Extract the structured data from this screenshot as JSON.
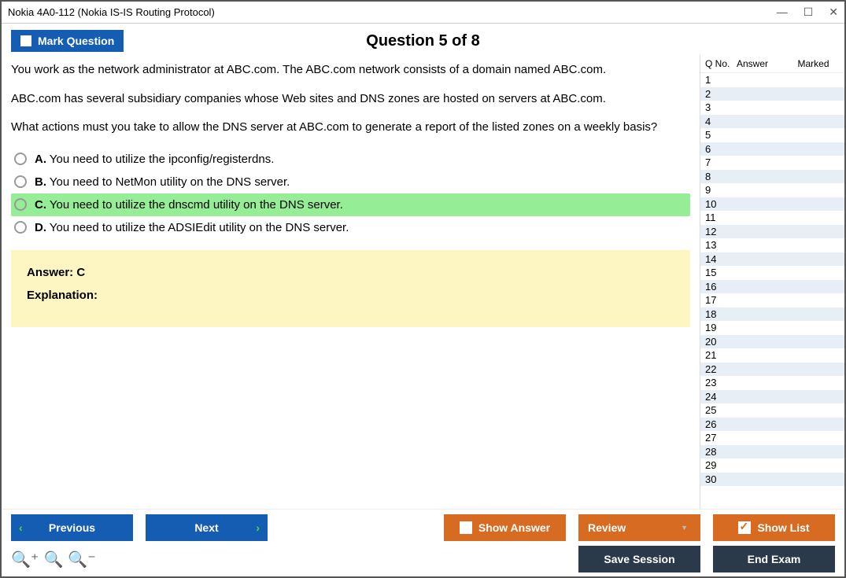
{
  "window": {
    "title": "Nokia 4A0-112 (Nokia IS-IS Routing Protocol)"
  },
  "topbar": {
    "mark_label": "Mark Question",
    "question_title": "Question 5 of 8"
  },
  "question": {
    "para1": "You work as the network administrator at ABC.com. The ABC.com network consists of a domain named ABC.com.",
    "para2": "ABC.com has several subsidiary companies whose Web sites and DNS zones are hosted on servers at ABC.com.",
    "para3": "What actions must you take to allow the DNS server at ABC.com to generate a report of the listed zones on a weekly basis?",
    "options": [
      {
        "letter": "A.",
        "text": "You need to utilize the ipconfig/registerdns.",
        "correct": false
      },
      {
        "letter": "B.",
        "text": "You need to NetMon utility on the DNS server.",
        "correct": false
      },
      {
        "letter": "C.",
        "text": "You need to utilize the dnscmd utility on the DNS server.",
        "correct": true
      },
      {
        "letter": "D.",
        "text": "You need to utilize the ADSIEdit utility on the DNS server.",
        "correct": false
      }
    ],
    "answer_label": "Answer: C",
    "explanation_label": "Explanation:"
  },
  "sidebar": {
    "h1": "Q No.",
    "h2": "Answer",
    "h3": "Marked",
    "rows": [
      "1",
      "2",
      "3",
      "4",
      "5",
      "6",
      "7",
      "8",
      "9",
      "10",
      "11",
      "12",
      "13",
      "14",
      "15",
      "16",
      "17",
      "18",
      "19",
      "20",
      "21",
      "22",
      "23",
      "24",
      "25",
      "26",
      "27",
      "28",
      "29",
      "30"
    ]
  },
  "footer": {
    "previous": "Previous",
    "next": "Next",
    "show_answer": "Show Answer",
    "review": "Review",
    "show_list": "Show List",
    "save_session": "Save Session",
    "end_exam": "End Exam"
  }
}
